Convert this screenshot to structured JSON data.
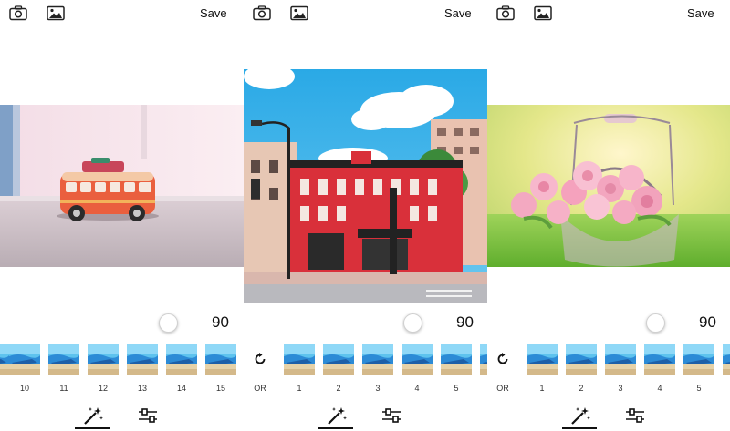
{
  "panels": [
    {
      "save_label": "Save",
      "slider_value": "90",
      "slider_level": 0.9,
      "thumb_labels": [
        "10",
        "11",
        "12",
        "13",
        "14",
        "15"
      ],
      "photo": "toy-bus"
    },
    {
      "save_label": "Save",
      "slider_value": "90",
      "slider_level": 0.9,
      "reset_label": "OR",
      "thumb_labels": [
        "1",
        "2",
        "3",
        "4",
        "5"
      ],
      "photo": "red-building"
    },
    {
      "save_label": "Save",
      "slider_value": "90",
      "slider_level": 0.9,
      "reset_label": "OR",
      "thumb_labels": [
        "1",
        "2",
        "3",
        "4",
        "5"
      ],
      "photo": "rose-basket"
    }
  ],
  "icons": {
    "camera": "camera-icon",
    "gallery": "image-gallery-icon",
    "reset": "reset-icon",
    "magic_wand": "magic-wand-icon",
    "adjust": "sliders-adjust-icon"
  },
  "colors": {
    "text": "#111111",
    "slider_track": "#bdbdbd",
    "sky_blue": "#3fb5e8",
    "brick_red": "#d9303a"
  }
}
